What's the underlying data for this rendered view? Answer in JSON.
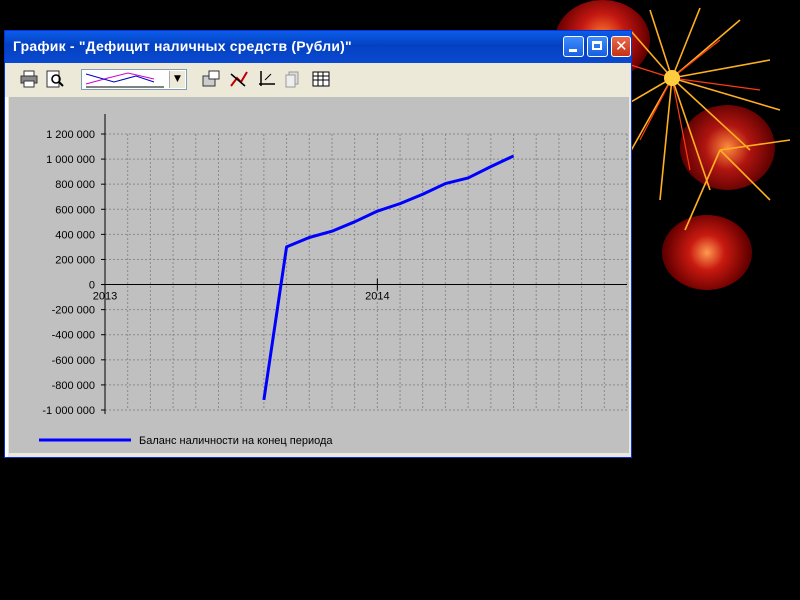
{
  "window": {
    "title": "График - \"Дефицит наличных средств (Рубли)\""
  },
  "toolbar": {
    "buttons": [
      "printer-icon",
      "print-preview-icon",
      "properties-icon",
      "trend-icon",
      "axes-icon",
      "copy-icon",
      "table-icon"
    ],
    "chart_type_selector": "line-chart-thumbnail"
  },
  "chart_data": {
    "type": "line",
    "x": [
      "2013-01",
      "2013-02",
      "2013-03",
      "2013-04",
      "2013-05",
      "2013-06",
      "2013-07",
      "2013-08",
      "2013-09",
      "2013-10",
      "2013-11",
      "2013-12",
      "2014-01",
      "2014-02",
      "2014-03",
      "2014-04",
      "2014-05",
      "2014-06",
      "2014-07",
      "2014-08",
      "2014-09",
      "2014-10",
      "2014-11",
      "2014-12"
    ],
    "x_tick_labels": [
      "2013",
      "2014"
    ],
    "y_ticks": [
      "1 200 000",
      "1 000 000",
      "800 000",
      "600 000",
      "400 000",
      "200 000",
      "0",
      "-200 000",
      "-400 000",
      "-600 000",
      "-800 000",
      "-1 000 000"
    ],
    "ylim": [
      -1000000,
      1200000
    ],
    "grid": true,
    "legend_position": "bottom-left",
    "series": [
      {
        "name": "Баланс наличности на конец периода",
        "color": "#0000ff",
        "points": [
          [
            "2013-08",
            -920000
          ],
          [
            "2013-09",
            300000
          ],
          [
            "2013-10",
            375000
          ],
          [
            "2013-11",
            425000
          ],
          [
            "2013-12",
            500000
          ],
          [
            "2014-01",
            585000
          ],
          [
            "2014-02",
            645000
          ],
          [
            "2014-03",
            720000
          ],
          [
            "2014-04",
            805000
          ],
          [
            "2014-05",
            850000
          ],
          [
            "2014-06",
            940000
          ],
          [
            "2014-07",
            1025000
          ]
        ]
      }
    ]
  }
}
